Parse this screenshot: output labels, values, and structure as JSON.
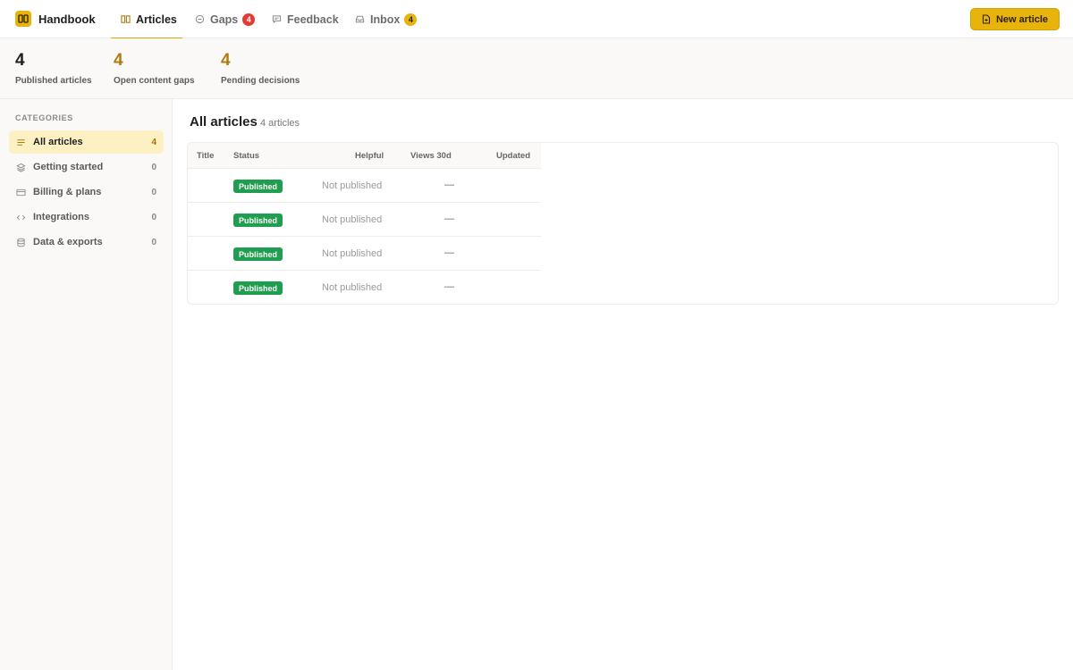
{
  "app": {
    "name": "Handbook"
  },
  "nav": {
    "tabs": [
      {
        "label": "Articles",
        "icon": "book-open-icon",
        "active": true
      },
      {
        "label": "Gaps",
        "icon": "circle-minus-icon",
        "badge": "4",
        "badge_color": "#e53935"
      },
      {
        "label": "Feedback",
        "icon": "message-square-icon"
      },
      {
        "label": "Inbox",
        "icon": "inbox-icon",
        "badge": "4",
        "badge_color": "#e8b30b"
      }
    ],
    "new_button_label": "New article"
  },
  "stats": [
    {
      "value": "4",
      "label": "Published articles",
      "color": "#1f1f1f"
    },
    {
      "value": "4",
      "label": "Open content gaps",
      "color": "#b07a12"
    },
    {
      "value": "4",
      "label": "Pending decisions",
      "color": "#b07a12"
    }
  ],
  "sidebar": {
    "heading": "CATEGORIES",
    "items": [
      {
        "label": "All articles",
        "count": "4",
        "icon": "list-icon",
        "active": true
      },
      {
        "label": "Getting started",
        "count": "0",
        "icon": "layers-icon"
      },
      {
        "label": "Billing & plans",
        "count": "0",
        "icon": "credit-card-icon"
      },
      {
        "label": "Integrations",
        "count": "0",
        "icon": "code-icon"
      },
      {
        "label": "Data & exports",
        "count": "0",
        "icon": "database-icon"
      }
    ]
  },
  "main": {
    "title": "All articles",
    "subtitle": "4 articles",
    "table": {
      "columns": [
        "Title",
        "Status",
        "Helpful",
        "Views 30d",
        "Updated"
      ],
      "rows": [
        {
          "title": "",
          "status": "Published",
          "helpful": "Not published",
          "views": "—",
          "updated": ""
        },
        {
          "title": "",
          "status": "Published",
          "helpful": "Not published",
          "views": "—",
          "updated": ""
        },
        {
          "title": "",
          "status": "Published",
          "helpful": "Not published",
          "views": "—",
          "updated": ""
        },
        {
          "title": "",
          "status": "Published",
          "helpful": "Not published",
          "views": "—",
          "updated": ""
        }
      ]
    }
  },
  "colors": {
    "accent": "#e8b30b",
    "published": "#1e9e4e",
    "gap_badge": "#e53935"
  }
}
